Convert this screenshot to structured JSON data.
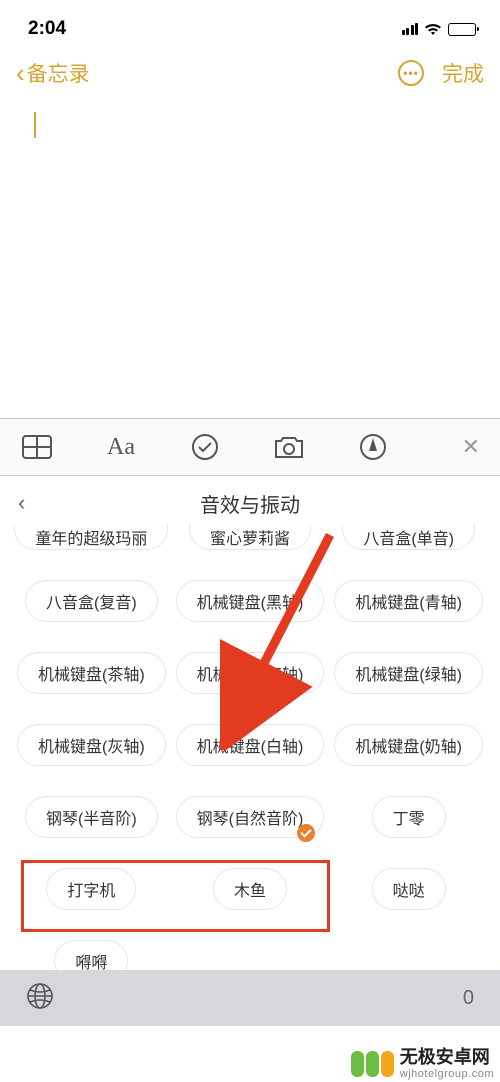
{
  "status": {
    "time": "2:04"
  },
  "nav": {
    "back_label": "备忘录",
    "done_label": "完成"
  },
  "panel": {
    "title": "音效与振动"
  },
  "chips": {
    "r0": [
      "童年的超级玛丽",
      "蜜心萝莉酱",
      "八音盒(单音)"
    ],
    "r1": [
      "八音盒(复音)",
      "机械键盘(黑轴)",
      "机械键盘(青轴)"
    ],
    "r2": [
      "机械键盘(茶轴)",
      "机械键盘(红轴)",
      "机械键盘(绿轴)"
    ],
    "r3": [
      "机械键盘(灰轴)",
      "机械键盘(白轴)",
      "机械键盘(奶轴)"
    ],
    "r4": [
      "钢琴(半音阶)",
      "钢琴(自然音阶)",
      "丁零"
    ],
    "r5": [
      "打字机",
      "木鱼",
      "哒哒"
    ],
    "r6": [
      "嘚嘚",
      "",
      ""
    ]
  },
  "watermark": {
    "name": "无极安卓网",
    "url": "wjhotelgroup.com"
  },
  "kb": {
    "zero": "0"
  }
}
